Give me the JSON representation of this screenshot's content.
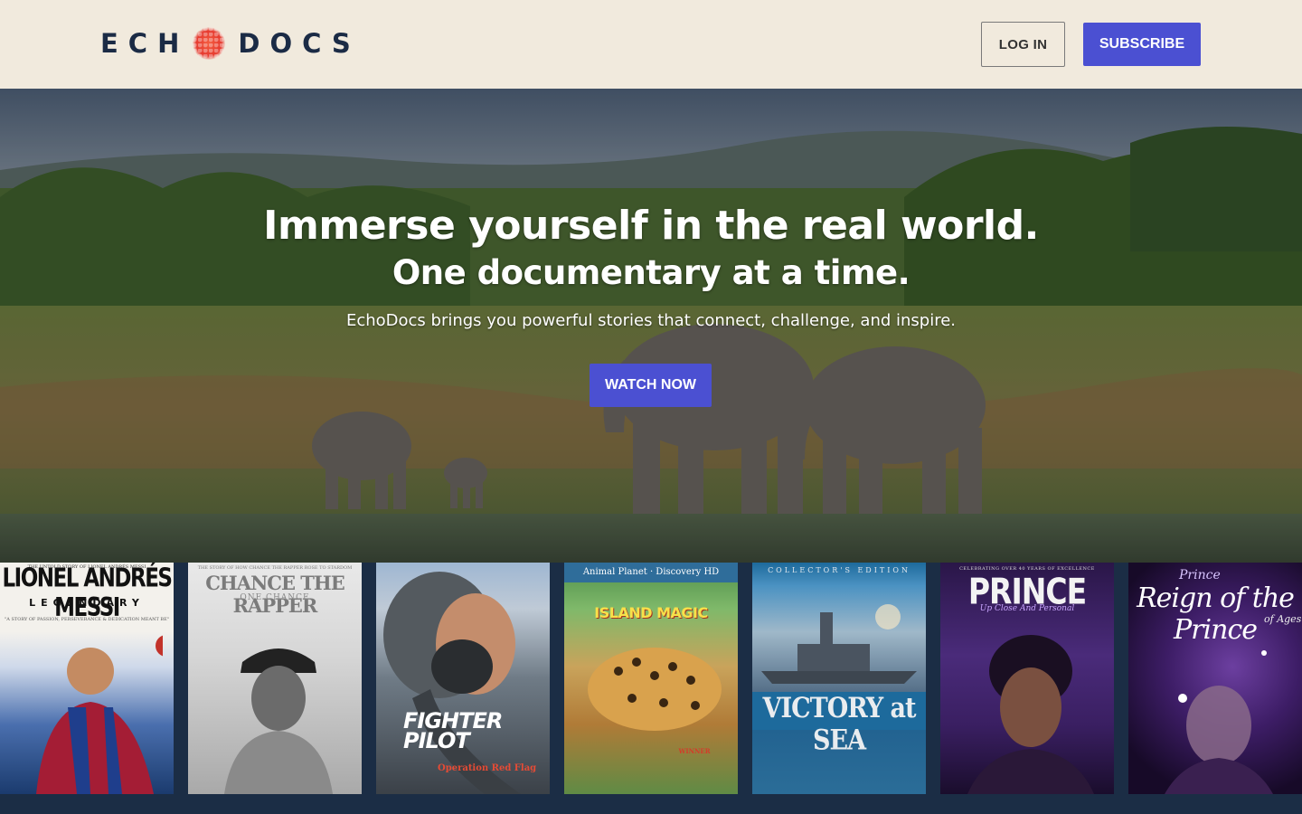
{
  "header": {
    "logo_left": "ECH",
    "logo_right": "DOCS",
    "login_label": "LOG IN",
    "subscribe_label": "SUBSCRIBE"
  },
  "hero": {
    "title": "Immerse yourself in the real world.",
    "subtitle": "One documentary at a time.",
    "description": "EchoDocs brings you powerful stories that connect, challenge, and inspire.",
    "cta_label": "WATCH NOW"
  },
  "posters": [
    {
      "kicker": "THE UNTOLD STORY OF LIONEL ANDRÉS MESSI",
      "title": "LIONEL ANDRÉS MESSI",
      "subtitle": "LEGENDARY",
      "tagline": "\"A STORY OF PASSION, PERSEVERANCE & DEDICATION MEANT BE\""
    },
    {
      "kicker": "THE STORY OF HOW CHANCE THE RAPPER ROSE TO STARDOM",
      "title": "CHANCE THE RAPPER",
      "subtitle": "ONE CHANCE"
    },
    {
      "title": "FIGHTER PILOT",
      "subtitle": "Operation Red Flag"
    },
    {
      "banner": "Animal Planet · Discovery HD",
      "title": "ISLAND MAGIC",
      "badge": "WINNER"
    },
    {
      "kicker": "COLLECTOR'S EDITION",
      "title": "VICTORY at SEA"
    },
    {
      "kicker": "CELEBRATING OVER 40 YEARS OF EXCELLENCE",
      "title": "PRINCE",
      "subtitle": "Up Close And Personal"
    },
    {
      "kicker": "Prince",
      "title": "Reign of the Prince",
      "subtitle": "of Ages"
    }
  ]
}
